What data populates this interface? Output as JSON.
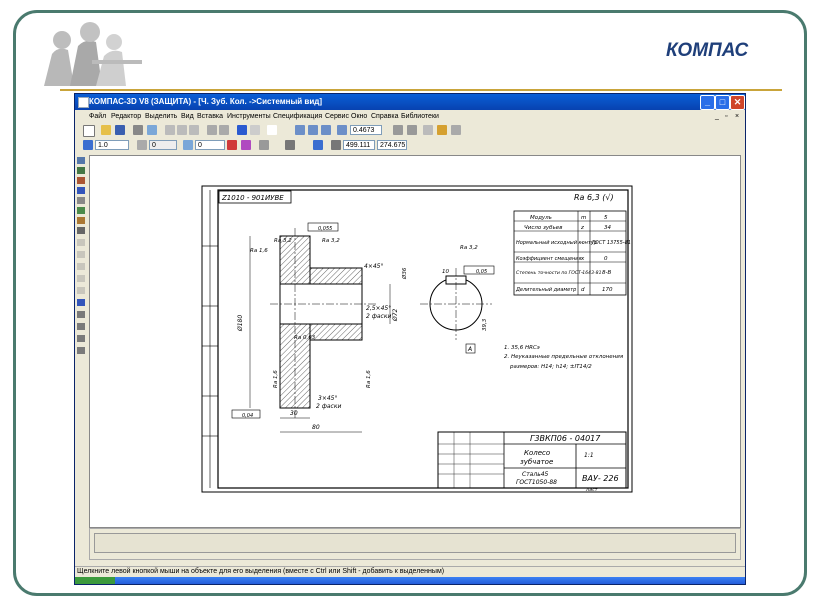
{
  "slide": {
    "title": "КОМПАС"
  },
  "window": {
    "title": "КОМПАС-3D V8 (ЗАЩИТА) - [Ч. Зуб. Кол. ->Системный вид]",
    "minimize": "_",
    "maximize": "□",
    "close": "✕"
  },
  "menu": {
    "items": [
      "Файл",
      "Редактор",
      "Выделить",
      "Вид",
      "Вставка",
      "Инструменты",
      "Спецификация",
      "Сервис",
      "Окно",
      "Справка",
      "Библиотеки"
    ]
  },
  "toolbar": {
    "zoom_value": "0.4673",
    "step_value": "1.0",
    "layer_value": "0",
    "style_value": "0",
    "coord_x": "499.111",
    "coord_y": "274.675"
  },
  "drawing": {
    "stamp_code": "Г3ВКП06 - 04017",
    "part_name_line1": "Колесо",
    "part_name_line2": "зубчатое",
    "material_line1": "Сталь45",
    "material_line2": "ГОСТ1050-88",
    "organization": "ВАУ- 226",
    "scale": "1:1",
    "sheet_label": "Лист",
    "top_left_box": "Z1010 - 901ИУВЕ",
    "roughness_main": "Ra 6,3 (√)",
    "table": [
      [
        "Модуль",
        "m",
        "5"
      ],
      [
        "Число зубьев",
        "z",
        "34"
      ],
      [
        "Нормальный исходный контур",
        "-",
        "ГОСТ 13755-81"
      ],
      [
        "Коэффициент смещения",
        "x",
        "0"
      ],
      [
        "Степень точности по ГОСТ 1643-81",
        "-",
        "8-В"
      ],
      [
        "Делительный диаметр",
        "d",
        "170"
      ]
    ],
    "notes": [
      "1. 35,6 HRCэ",
      "2. Неуказанные предельные отклонения",
      "размеров: Н14; h14; ±IT14/2"
    ],
    "dims": {
      "d1": "Ø180",
      "d2": "Ø72",
      "d3": "Ø36",
      "len1": "30",
      "len2": "80",
      "ch1": "4×45°",
      "ch2": "2,5×45°",
      "ch3": "3×45°",
      "ch4": "2 фаски",
      "k1": "10",
      "k2": "39,3",
      "tol1": "0,055",
      "tol2": "0,04",
      "tol3": "0,05",
      "rough1": "Ra 1,6",
      "rough2": "Ra 3,2",
      "rough3": "Ra 0,63",
      "rough4": "Ra 3,2",
      "rough5": "Ra 1,6",
      "rough6": "Ra 1,6",
      "base_a": "A"
    }
  },
  "status": {
    "text": "Щелкните левой кнопкой мыши на объекте для его выделения (вместе с Ctrl или Shift - добавить к выделенным)"
  }
}
